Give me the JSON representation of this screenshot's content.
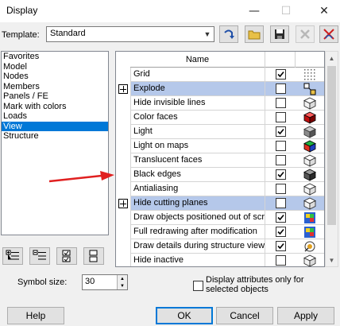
{
  "window": {
    "title": "Display",
    "minimize_glyph": "—",
    "maximize_glyph": "☐",
    "close_glyph": "✕"
  },
  "template": {
    "label": "Template:",
    "value": "Standard"
  },
  "categories": [
    {
      "label": "Favorites",
      "selected": false
    },
    {
      "label": "Model",
      "selected": false
    },
    {
      "label": "Nodes",
      "selected": false
    },
    {
      "label": "Members",
      "selected": false
    },
    {
      "label": "Panels / FE",
      "selected": false
    },
    {
      "label": "Mark with colors",
      "selected": false
    },
    {
      "label": "Loads",
      "selected": false
    },
    {
      "label": "View",
      "selected": true
    },
    {
      "label": "Structure",
      "selected": false
    }
  ],
  "table": {
    "header_name": "Name",
    "rows": [
      {
        "name": "Grid",
        "checked": true,
        "expandable": false,
        "highlighted": false,
        "icon": "grid-icon"
      },
      {
        "name": "Explode",
        "checked": false,
        "expandable": true,
        "highlighted": true,
        "icon": "explode-icon"
      },
      {
        "name": "Hide invisible lines",
        "checked": false,
        "expandable": false,
        "highlighted": false,
        "icon": "cube-wire-icon"
      },
      {
        "name": "Color faces",
        "checked": false,
        "expandable": false,
        "highlighted": false,
        "icon": "cube-red-icon"
      },
      {
        "name": "Light",
        "checked": true,
        "expandable": false,
        "highlighted": false,
        "icon": "cube-gray-icon"
      },
      {
        "name": "Light on maps",
        "checked": false,
        "expandable": false,
        "highlighted": false,
        "icon": "cube-color-icon"
      },
      {
        "name": "Translucent faces",
        "checked": false,
        "expandable": false,
        "highlighted": false,
        "icon": "cube-wire-icon"
      },
      {
        "name": "Black edges",
        "checked": true,
        "expandable": false,
        "highlighted": false,
        "icon": "cube-dark-icon"
      },
      {
        "name": "Antialiasing",
        "checked": false,
        "expandable": false,
        "highlighted": false,
        "icon": "cube-wire-icon"
      },
      {
        "name": "Hide cutting planes",
        "checked": false,
        "expandable": true,
        "highlighted": true,
        "icon": "cube-wire-icon"
      },
      {
        "name": "Draw objects positioned out of scre...",
        "checked": true,
        "expandable": false,
        "highlighted": false,
        "icon": "map-icon"
      },
      {
        "name": "Full redrawing after modification",
        "checked": true,
        "expandable": false,
        "highlighted": false,
        "icon": "map-icon"
      },
      {
        "name": "Draw details during structure viewing",
        "checked": true,
        "expandable": false,
        "highlighted": false,
        "icon": "detail-icon"
      },
      {
        "name": "Hide inactive",
        "checked": false,
        "expandable": false,
        "highlighted": false,
        "icon": "cube-wire-icon"
      }
    ]
  },
  "symbol_size": {
    "label": "Symbol size:",
    "value": "30"
  },
  "attributes_option": {
    "label": "Display attributes only for selected objects",
    "checked": false
  },
  "buttons": {
    "help": "Help",
    "ok": "OK",
    "cancel": "Cancel",
    "apply": "Apply"
  },
  "colors": {
    "selection": "#0078d7",
    "row_highlight": "#b5c8ea",
    "annotation_arrow": "#e02020"
  }
}
